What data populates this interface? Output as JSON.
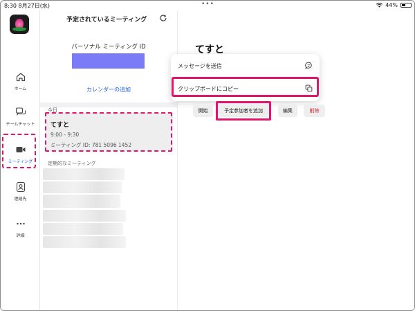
{
  "status_bar": {
    "time_date": "8:30  8月27日(水)",
    "battery": "44%",
    "battery_level": 0.44
  },
  "rail": {
    "items": [
      {
        "label": "ホーム",
        "icon": "home-icon"
      },
      {
        "label": "チームチャット",
        "icon": "chat-icon"
      },
      {
        "label": "ミーティング",
        "icon": "video-camera-icon",
        "active": true
      },
      {
        "label": "連絡先",
        "icon": "contact-icon"
      },
      {
        "label": "詳細",
        "icon": "more-icon"
      }
    ]
  },
  "list_pane": {
    "title": "予定されているミーティング",
    "pmi_label": "パーソナル ミーティング ID",
    "calendar_link": "カレンダーの追加",
    "today_label": "今日",
    "meeting": {
      "title": "てすと",
      "time": "9:00 - 9:30",
      "id": "ミーティング ID: 781 5096 1452"
    },
    "recurring_label": "定期的なミーティング"
  },
  "detail": {
    "title": "てすと"
  },
  "popup": {
    "send_message": "メッセージを送信",
    "copy_clipboard": "クリップボードにコピー"
  },
  "actions": {
    "start": "開始",
    "add_invitees": "予定参加者を追加",
    "edit": "編集",
    "delete": "削除"
  },
  "colors": {
    "highlight": "#e0156d",
    "accent": "#0b5cff",
    "pmi_mask": "#7b7bf7",
    "danger": "#d2262b"
  }
}
